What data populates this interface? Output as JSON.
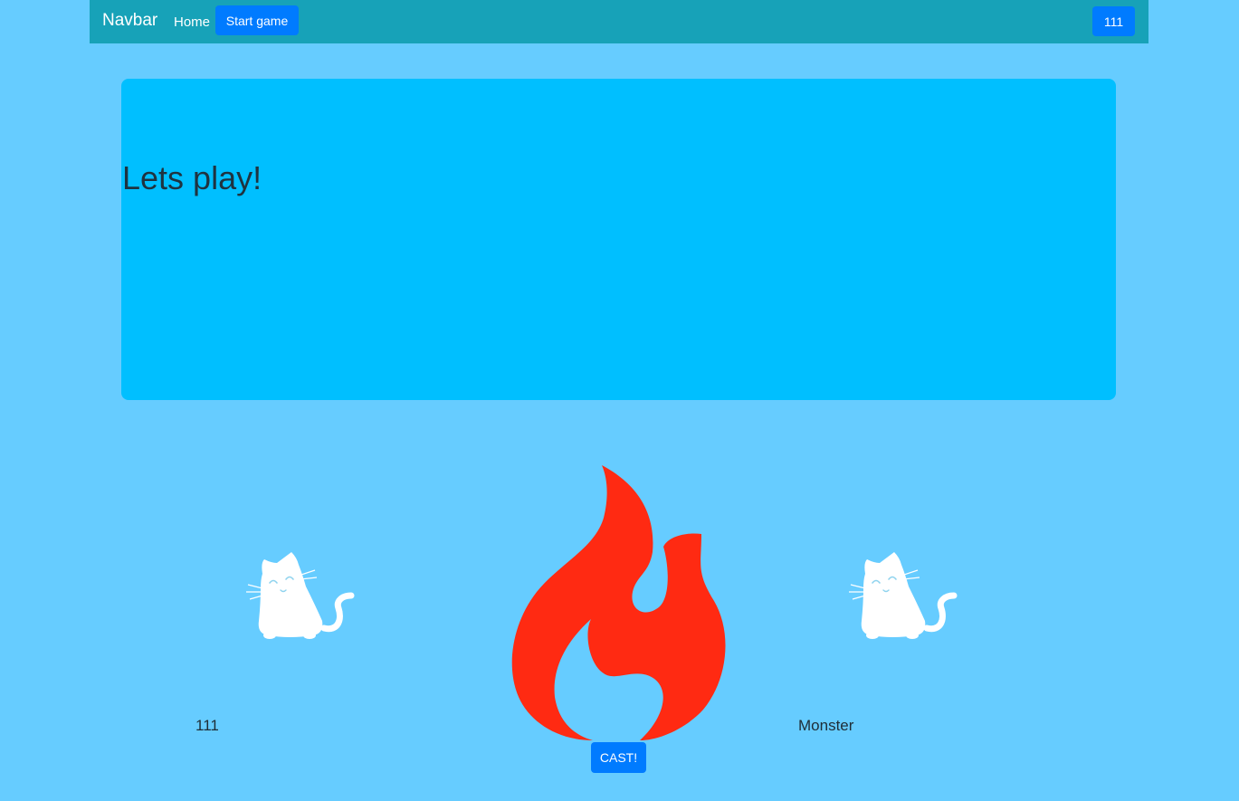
{
  "navbar": {
    "brand": "Navbar",
    "home_link": "Home",
    "start_button": "Start game",
    "user_button": "111"
  },
  "hero": {
    "title": "Lets play!"
  },
  "battle": {
    "player_name": "111",
    "monster_name": "Monster",
    "cast_button": "CAST!",
    "player_icon": "cat-icon",
    "monster_icon": "cat-icon",
    "spell_icon": "fire-icon"
  },
  "colors": {
    "page_background": "#66ccff",
    "navbar": "#17a2b8",
    "hero": "#00bfff",
    "primary_button": "#007bff",
    "fire": "#ff2a12"
  }
}
